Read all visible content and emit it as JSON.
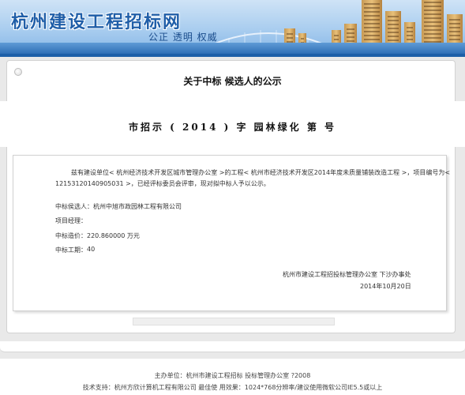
{
  "header": {
    "site_title": "杭州建设工程招标网",
    "slogan": "公正 透明 权威"
  },
  "announcement": {
    "title": "关于中标 候选人的公示",
    "doc_number": "市招示 ( 2014 ) 字 园林绿化 第 号",
    "body_line1": "兹有建设单位< 杭州经济技术开发区城市管理办公室 >的工程< 杭州市经济技术开发区2014年度未质量铺装改造工程 >，项目编号为<",
    "body_line2": "12153120140905031 >，已经评标委员会评审，现对拟中标人予以公示。",
    "fields": [
      {
        "label": "中标侯选人：",
        "value": "杭州中旭市政园林工程有限公司"
      },
      {
        "label": "项目经理：",
        "value": ""
      },
      {
        "label": "中标造价：",
        "value": "220.860000 万元"
      },
      {
        "label": "中标工期：",
        "value": "40"
      }
    ],
    "issuer": "杭州市建设工程招投标管理办公室 下沙办事处",
    "date": "2014年10月20日"
  },
  "footer": {
    "line1": "主办单位：杭州市建设工程招标 投标管理办公室 ?2008",
    "line2": "技术支持：杭州方欣计算机工程有限公司 最佳使 用效果：1024*768分辨率/建议使用微软公司IE5.5或以上"
  }
}
